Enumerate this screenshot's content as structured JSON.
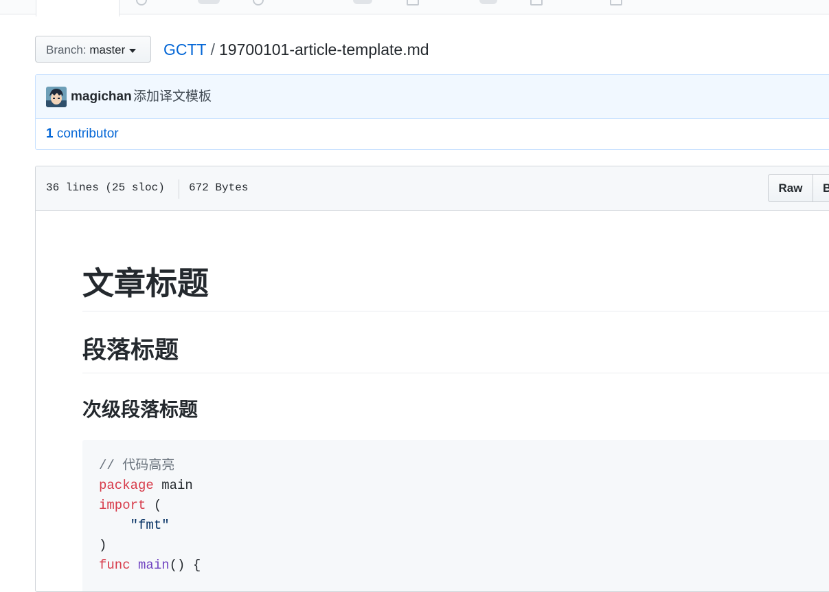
{
  "branch": {
    "label": "Branch:",
    "value": "master"
  },
  "breadcrumb": {
    "repo": "GCTT",
    "separator": "/",
    "file": "19700101-article-template.md"
  },
  "commit": {
    "author": "magichan",
    "message": "添加译文模板"
  },
  "contributors": {
    "count": "1",
    "label": "contributor"
  },
  "file": {
    "lines": "36 lines (25 sloc)",
    "size": "672 Bytes",
    "raw_label": "Raw",
    "blame_label": "B"
  },
  "markdown": {
    "h1": "文章标题",
    "h2": "段落标题",
    "h3": "次级段落标题",
    "code": {
      "comment": "// 代码高亮",
      "line2_kw": "package",
      "line2_rest": " main",
      "line3_kw": "import",
      "line3_rest": " (",
      "line4_str": "\"fmt\"",
      "line5": ")",
      "line6_kw": "func",
      "line6_fn": "main",
      "line6_rest": "() {"
    }
  }
}
